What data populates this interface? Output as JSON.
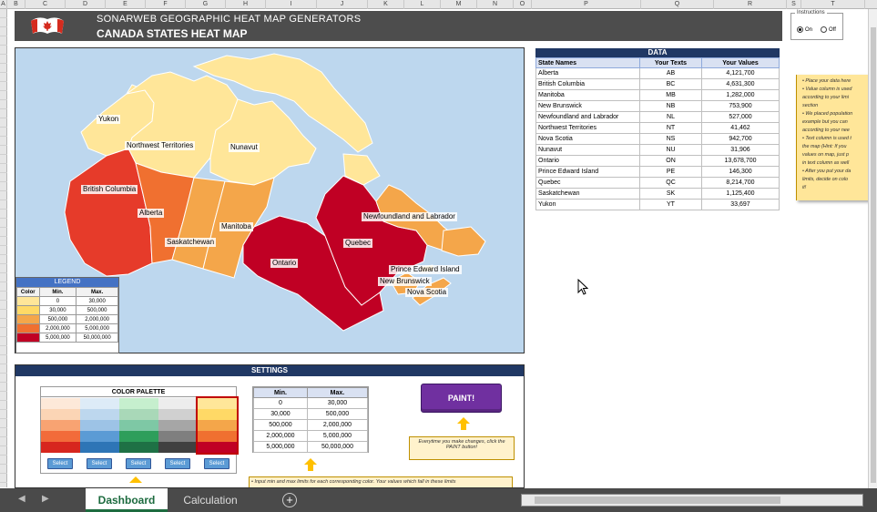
{
  "columns": [
    "A",
    "B",
    "C",
    "D",
    "E",
    "F",
    "G",
    "H",
    "I",
    "J",
    "K",
    "L",
    "M",
    "N",
    "O",
    "P",
    "Q",
    "R",
    "S",
    "T"
  ],
  "header": {
    "title_line1": "SONARWEB GEOGRAPHIC HEAT MAP GENERATORS",
    "title_line2": "CANADA STATES HEAT MAP"
  },
  "instructions": {
    "label": "Instructions",
    "on": "On",
    "off": "Off",
    "selected": "On"
  },
  "map": {
    "labels": {
      "yukon": "Yukon",
      "nwt": "Northwest Territories",
      "nunavut": "Nunavut",
      "bc": "British Columbia",
      "alberta": "Alberta",
      "saskatchewan": "Saskatchewan",
      "manitoba": "Manitoba",
      "ontario": "Ontario",
      "quebec": "Quebec",
      "nl": "Newfoundland and Labrador",
      "pei": "Prince Edward Island",
      "nb": "New Brunswick",
      "ns": "Nova Scotia"
    },
    "colors": {
      "water": "#bdd7ee",
      "c1": "#ffe699",
      "c2": "#ffd966",
      "c3": "#f4a64a",
      "c4": "#f07030",
      "c5": "#e63b2a",
      "c6": "#c00024"
    }
  },
  "legend": {
    "title": "LEGEND",
    "headers": [
      "Color",
      "Min.",
      "Max."
    ],
    "rows": [
      {
        "color": "#ffe699",
        "min": "0",
        "max": "30,000"
      },
      {
        "color": "#ffd966",
        "min": "30,000",
        "max": "500,000"
      },
      {
        "color": "#f4a64a",
        "min": "500,000",
        "max": "2,000,000"
      },
      {
        "color": "#f07030",
        "min": "2,000,000",
        "max": "5,000,000"
      },
      {
        "color": "#c00024",
        "min": "5,000,000",
        "max": "50,000,000"
      }
    ]
  },
  "data_table": {
    "title": "DATA",
    "headers": [
      "State Names",
      "Your Texts",
      "Your Values"
    ],
    "rows": [
      {
        "name": "Alberta",
        "code": "AB",
        "value": "4,121,700"
      },
      {
        "name": "British Columbia",
        "code": "BC",
        "value": "4,631,300"
      },
      {
        "name": "Manitoba",
        "code": "MB",
        "value": "1,282,000"
      },
      {
        "name": "New Brunswick",
        "code": "NB",
        "value": "753,900"
      },
      {
        "name": "Newfoundland and Labrador",
        "code": "NL",
        "value": "527,000"
      },
      {
        "name": "Northwest Territories",
        "code": "NT",
        "value": "41,462"
      },
      {
        "name": "Nova Scotia",
        "code": "NS",
        "value": "942,700"
      },
      {
        "name": "Nunavut",
        "code": "NU",
        "value": "31,906"
      },
      {
        "name": "Ontario",
        "code": "ON",
        "value": "13,678,700"
      },
      {
        "name": "Prince Edward Island",
        "code": "PE",
        "value": "146,300"
      },
      {
        "name": "Quebec",
        "code": "QC",
        "value": "8,214,700"
      },
      {
        "name": "Saskatchewan",
        "code": "SK",
        "value": "1,125,400"
      },
      {
        "name": "Yukon",
        "code": "YT",
        "value": "33,697"
      }
    ]
  },
  "side_note": {
    "lines": [
      "• Place your data here",
      "• Value column is used",
      "  according to your limi",
      "  section",
      "• We placed population",
      "  example but you can",
      "  according to your nee",
      "• Text column is used t",
      "  the map (Hint: If you",
      "  values on map, just p",
      "  in text column as well",
      "• After you put your da",
      "  limits, decide on colo",
      "  it!"
    ]
  },
  "settings": {
    "title": "SETTINGS",
    "palette_title": "COLOR PALETTE",
    "palettes": [
      [
        "#fde9d9",
        "#fbd5b5",
        "#f8a372",
        "#f26b3a",
        "#d7261e"
      ],
      [
        "#ddebf7",
        "#bdd7ee",
        "#9dc3e6",
        "#5b9bd5",
        "#2e75b6"
      ],
      [
        "#c6efce",
        "#a9d8b8",
        "#7ec8a5",
        "#2e9e5b",
        "#1e7145"
      ],
      [
        "#ededed",
        "#d0d0d0",
        "#a6a6a6",
        "#7f7f7f",
        "#404040"
      ],
      [
        "#ffe699",
        "#ffd966",
        "#f4a64a",
        "#f07030",
        "#c00024"
      ]
    ],
    "select_label": "Select",
    "range_headers": [
      "Min.",
      "Max."
    ],
    "ranges": [
      {
        "min": "0",
        "max": "30,000"
      },
      {
        "min": "30,000",
        "max": "500,000"
      },
      {
        "min": "500,000",
        "max": "2,000,000"
      },
      {
        "min": "2,000,000",
        "max": "5,000,000"
      },
      {
        "min": "5,000,000",
        "max": "50,000,000"
      }
    ],
    "paint_label": "PAINT!",
    "paint_note": "Everytime you make changes, click the PAINT button!",
    "bottom_note": "•  Input min and max limits for each corresponding color. Your values which fall in these limits"
  },
  "tabs": [
    {
      "label": "Dashboard",
      "active": true
    },
    {
      "label": "Calculation",
      "active": false
    }
  ]
}
